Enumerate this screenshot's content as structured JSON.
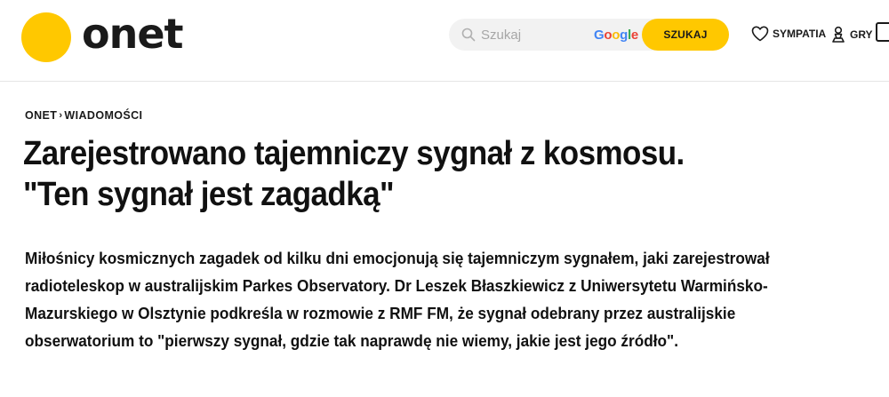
{
  "header": {
    "logo_text": "onet",
    "search": {
      "placeholder": "Szukaj",
      "provider": "Google",
      "button_label": "SZUKAJ"
    },
    "nav": {
      "sympatia_label": "SYMPATIA",
      "gry_label": "GRY"
    }
  },
  "breadcrumb": {
    "items": [
      "ONET",
      "WIADOMOŚCI"
    ],
    "separator": "›"
  },
  "article": {
    "title_line1": "Zarejestrowano tajemniczy sygnał z kosmosu.",
    "title_line2": "\"Ten sygnał jest zagadką\"",
    "lead": "Miłośnicy kosmicznych zagadek od kilku dni emocjonują się tajemniczym sygnałem, jaki zarejestrował radioteleskop w australijskim Parkes Observatory. Dr Leszek Błaszkiewicz z Uniwersytetu Warmińsko-Mazurskiego w Olsztynie podkreśla w rozmowie z RMF FM, że sygnał odebrany przez australijskie obserwatorium to \"pierwszy sygnał, gdzie tak naprawdę nie wiemy, jakie jest jego źródło\"."
  },
  "colors": {
    "brand_yellow": "#ffc800",
    "text": "#111111",
    "search_bg": "#f2f2f2"
  },
  "icons": [
    "search-icon",
    "heart-icon",
    "game-piece-icon"
  ]
}
